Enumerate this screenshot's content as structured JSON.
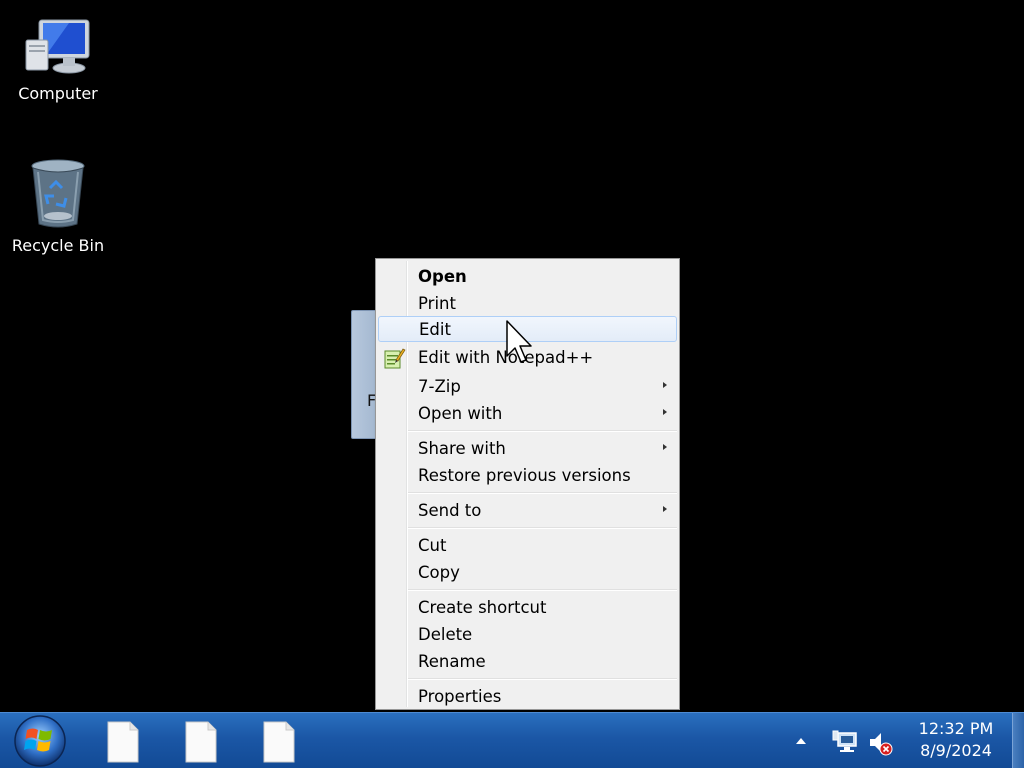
{
  "desktop": {
    "icons": [
      {
        "label": "Computer",
        "icon": "computer-icon"
      },
      {
        "label": "Recycle Bin",
        "icon": "recycle-bin-icon"
      }
    ],
    "selected_file_partial_label": "F"
  },
  "context_menu": {
    "items": [
      {
        "label": "Open",
        "bold": true
      },
      {
        "label": "Print"
      },
      {
        "label": "Edit",
        "highlighted": true
      },
      {
        "label": "Edit with Notepad++",
        "icon": "notepad-plus-plus-icon"
      },
      {
        "label": "7-Zip",
        "submenu": true
      },
      {
        "label": "Open with",
        "submenu": true
      },
      {
        "label": "Share with",
        "submenu": true
      },
      {
        "label": "Restore previous versions"
      },
      {
        "label": "Send to",
        "submenu": true
      },
      {
        "label": "Cut"
      },
      {
        "label": "Copy"
      },
      {
        "label": "Create shortcut"
      },
      {
        "label": "Delete"
      },
      {
        "label": "Rename"
      },
      {
        "label": "Properties"
      }
    ]
  },
  "taskbar": {
    "start_icon": "windows-start-orb-icon",
    "pinned_items": [
      "file-icon",
      "file-icon",
      "file-icon"
    ],
    "tray": {
      "overflow_icon": "show-hidden-icons-arrow-icon",
      "network_icon": "network-icon",
      "volume_icon": "volume-muted-icon"
    },
    "clock": {
      "time": "12:32 PM",
      "date": "8/9/2024"
    }
  },
  "colors": {
    "taskbar": "#1b57a6",
    "menu_background": "#f0f0f0",
    "menu_highlight_border": "#aecff7"
  }
}
